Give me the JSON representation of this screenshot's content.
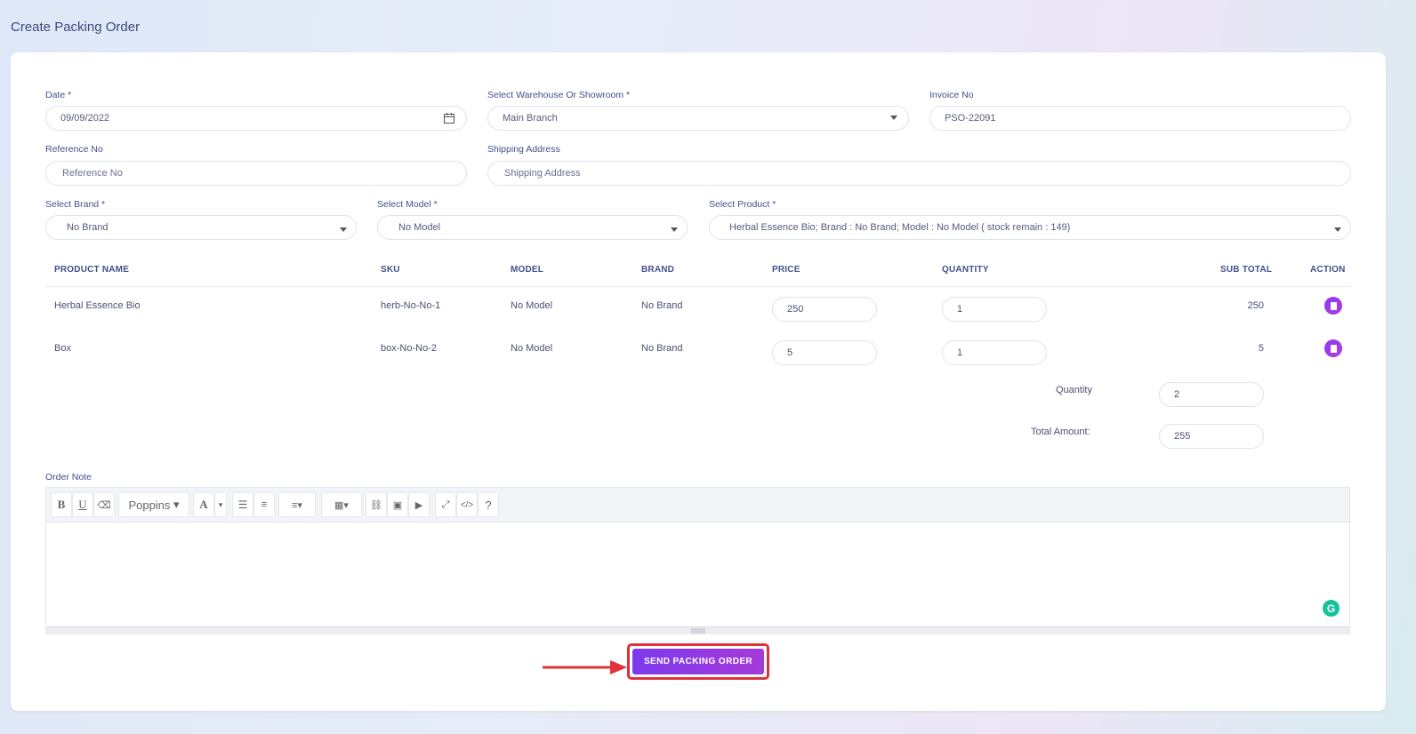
{
  "page_title": "Create Packing Order",
  "form": {
    "date_label": "Date *",
    "date_value": "09/09/2022",
    "warehouse_label": "Select Warehouse Or Showroom *",
    "warehouse_value": "Main Branch",
    "invoice_label": "Invoice No",
    "invoice_value": "PSO-22091",
    "reference_label": "Reference No",
    "reference_placeholder": "Reference No",
    "shipping_label": "Shipping Address",
    "shipping_placeholder": "Shipping Address",
    "brand_label": "Select Brand *",
    "brand_value": "No Brand",
    "model_label": "Select Model *",
    "model_value": "No Model",
    "product_label": "Select Product *",
    "product_value": "Herbal Essence Bio; Brand : No Brand; Model : No Model ( stock remain : 149)"
  },
  "table": {
    "headers": [
      "PRODUCT NAME",
      "SKU",
      "MODEL",
      "BRAND",
      "PRICE",
      "QUANTITY",
      "SUB TOTAL",
      "ACTION"
    ],
    "rows": [
      {
        "name": "Herbal Essence Bio",
        "sku": "herb-No-No-1",
        "model": "No Model",
        "brand": "No Brand",
        "price": "250",
        "quantity": "1",
        "subtotal": "250"
      },
      {
        "name": "Box",
        "sku": "box-No-No-2",
        "model": "No Model",
        "brand": "No Brand",
        "price": "5",
        "quantity": "1",
        "subtotal": "5"
      }
    ],
    "action_icon": "delete-icon"
  },
  "summary": {
    "quantity_label": "Quantity",
    "quantity_value": "2",
    "total_label": "Total Amount:",
    "total_value": "255"
  },
  "editor": {
    "label": "Order Note",
    "font_name": "Poppins",
    "toolbar_icons": [
      "bold-icon",
      "underline-icon",
      "eraser-icon",
      "font-family-dropdown",
      "font-color-icon",
      "unordered-list-icon",
      "ordered-list-icon",
      "align-icon",
      "table-icon",
      "link-icon",
      "image-icon",
      "video-icon",
      "fullscreen-icon",
      "code-view-icon",
      "help-icon"
    ]
  },
  "submit_label": "SEND PACKING ORDER",
  "colors": {
    "accent": "#7c3aed",
    "highlight": "#e0323a",
    "grammarly": "#15c39a"
  }
}
